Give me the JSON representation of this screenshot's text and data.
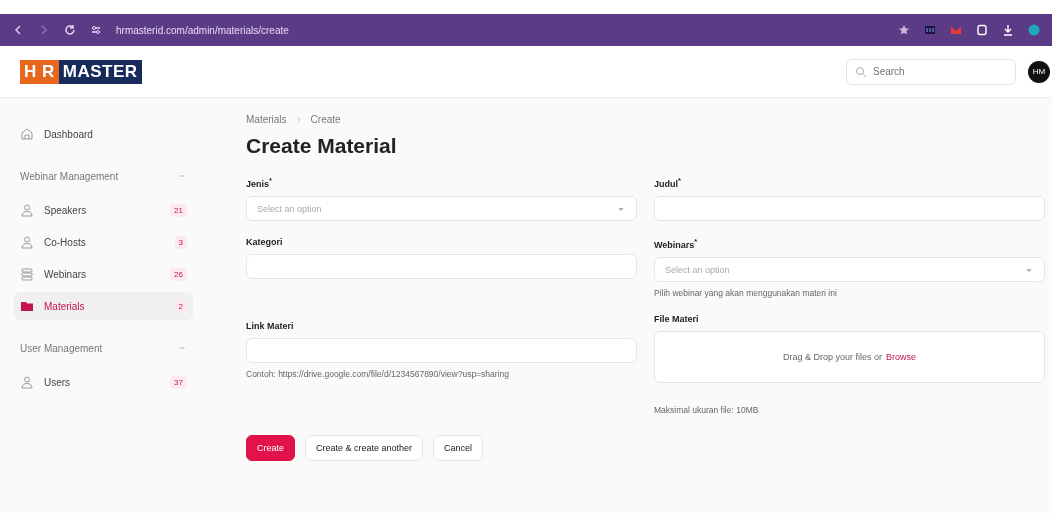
{
  "browser": {
    "url": "hrmasterid.com/admin/materials/create"
  },
  "header": {
    "logo": [
      {
        "text": "H R",
        "kind": "accent"
      },
      {
        "text": "MASTER",
        "kind": "main"
      }
    ],
    "search": {
      "placeholder": "Search"
    },
    "avatar": "HM"
  },
  "sidebar": {
    "items": [
      {
        "kind": "link",
        "label": "Dashboard",
        "selected": false
      },
      {
        "kind": "group",
        "label": "Webinar Management",
        "expanded": true,
        "children": [
          {
            "label": "Speakers",
            "kind": "person",
            "badge": "21",
            "selected": false
          },
          {
            "label": "Co-Hosts",
            "kind": "person",
            "badge": "3",
            "selected": false
          },
          {
            "label": "Webinars",
            "kind": "stack",
            "badge": "26",
            "selected": false
          },
          {
            "label": "Materials",
            "kind": "folder",
            "badge": "2",
            "selected": true
          }
        ]
      },
      {
        "kind": "group",
        "label": "User Management",
        "expanded": true,
        "children": [
          {
            "label": "Users",
            "kind": "person",
            "badge": "37",
            "selected": false
          }
        ]
      }
    ]
  },
  "breadcrumb": [
    "Materials",
    "Create"
  ],
  "title": "Create Material",
  "columns": [
    [
      {
        "kind": "select",
        "label": "Jenis$^{*}$",
        "placeholder": "Select an option"
      },
      {
        "kind": "text",
        "label": "Kategori"
      },
      {
        "kind": "text",
        "label": "Link Materi",
        "hint": "Contoh: https://drive.google.com/file/d/1234567890/view?usp=sharing"
      }
    ],
    [
      {
        "kind": "text",
        "label": "Judul$^{*}$"
      },
      {
        "kind": "select",
        "label": "Webinars$^{*}$",
        "placeholder": "Select an option",
        "hint": "Pilih webinar yang akan menggunakan materi ini"
      },
      {
        "kind": "upload",
        "label": "File Materi",
        "drop_text": "Drag & Drop your files or",
        "link": "Browse",
        "hint": "Maksimal ukuran file: 10MB"
      }
    ]
  ],
  "buttons": [
    {
      "label": "Create",
      "kind": "primary"
    },
    {
      "label": "Create & create another",
      "kind": "secondary"
    },
    {
      "label": "Cancel",
      "kind": "secondary"
    }
  ]
}
